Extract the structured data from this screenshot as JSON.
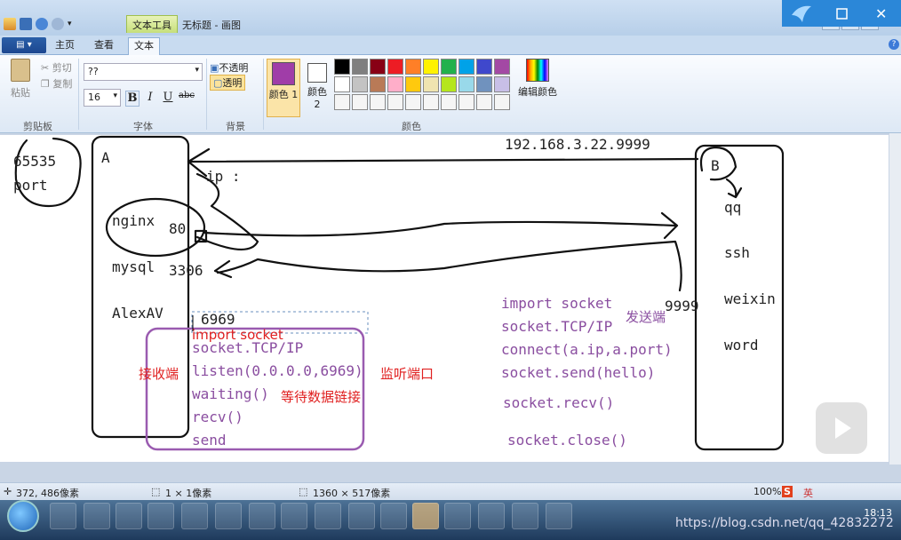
{
  "window": {
    "context_tab": "文本工具",
    "title": "无标题 - 画图"
  },
  "tabs": [
    "主页",
    "查看",
    "文本"
  ],
  "ribbon": {
    "clipboard": {
      "paste": "粘贴",
      "cut": "剪切",
      "copy": "复制",
      "group": "剪贴板"
    },
    "font": {
      "name": "??",
      "size": "16",
      "bold": "B",
      "italic": "I",
      "underline": "U",
      "strike": "abc",
      "group": "字体"
    },
    "background": {
      "opaque": "不透明",
      "transparent": "透明",
      "group": "背景"
    },
    "colors": {
      "color1": "颜色 1",
      "color2": "颜色 2",
      "color1_value": "#a03da8",
      "color2_value": "#ffffff",
      "edit": "编辑颜色",
      "group": "颜色",
      "palette": [
        "#000000",
        "#7f7f7f",
        "#880015",
        "#ed1c24",
        "#ff7f27",
        "#fff200",
        "#22b14c",
        "#00a2e8",
        "#3f48cc",
        "#a349a4",
        "#ffffff",
        "#c3c3c3",
        "#b97a57",
        "#ffaec9",
        "#ffc90e",
        "#efe4b0",
        "#b5e61d",
        "#99d9ea",
        "#7092be",
        "#c8bfe7",
        "#f5f5f5",
        "#f5f5f5",
        "#f5f5f5",
        "#f5f5f5",
        "#f5f5f5",
        "#f5f5f5",
        "#f5f5f5",
        "#f5f5f5",
        "#f5f5f5",
        "#f5f5f5"
      ]
    }
  },
  "drawing": {
    "port_max": "65535",
    "port": "port",
    "host_a": "A",
    "nginx": "nginx",
    "nginx_port": "80",
    "mysql": "mysql",
    "mysql_port": "3306",
    "alexav": "AlexAV",
    "ip_label": "ip :",
    "server_port": "6969",
    "address": "192.168.3.22.9999",
    "host_b": "B",
    "b_port": "9999",
    "b_apps": [
      "qq",
      "ssh",
      "weixin",
      "word"
    ],
    "server_code": {
      "import": "import socket",
      "tcp": "socket.TCP/IP",
      "listen": "listen(0.0.0.0,6969)",
      "listen_note": "监听端口",
      "waiting": "waiting()",
      "waiting_note": "等待数据链接",
      "recv": "recv()",
      "send": "send",
      "receiver_label": "接收端"
    },
    "client_code": {
      "import": "import socket",
      "tcp": "socket.TCP/IP",
      "sender_label": "发送端",
      "connect": "connect(a.ip,a.port)",
      "send": "socket.send(hello)",
      "recv": "socket.recv()",
      "close": "socket.close()"
    }
  },
  "status": {
    "cursor": "372, 486像素",
    "selection": "1 × 1像素",
    "canvas_size": "1360 × 517像素",
    "zoom": "100%"
  },
  "tray": {
    "ime": "英",
    "clock": "18:13",
    "watermark": "https://blog.csdn.net/qq_42832272"
  }
}
